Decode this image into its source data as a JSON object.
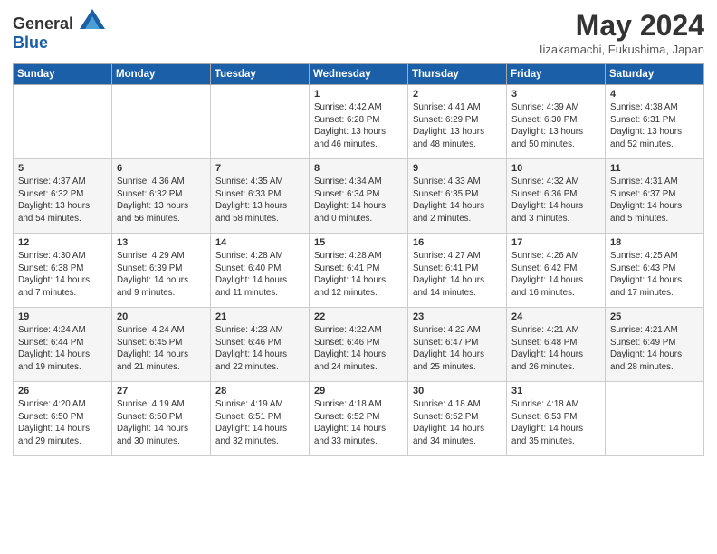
{
  "header": {
    "logo_general": "General",
    "logo_blue": "Blue",
    "month_title": "May 2024",
    "location": "Iizakamachi, Fukushima, Japan"
  },
  "days_of_week": [
    "Sunday",
    "Monday",
    "Tuesday",
    "Wednesday",
    "Thursday",
    "Friday",
    "Saturday"
  ],
  "weeks": [
    [
      {
        "day": "",
        "content": ""
      },
      {
        "day": "",
        "content": ""
      },
      {
        "day": "",
        "content": ""
      },
      {
        "day": "1",
        "content": "Sunrise: 4:42 AM\nSunset: 6:28 PM\nDaylight: 13 hours\nand 46 minutes."
      },
      {
        "day": "2",
        "content": "Sunrise: 4:41 AM\nSunset: 6:29 PM\nDaylight: 13 hours\nand 48 minutes."
      },
      {
        "day": "3",
        "content": "Sunrise: 4:39 AM\nSunset: 6:30 PM\nDaylight: 13 hours\nand 50 minutes."
      },
      {
        "day": "4",
        "content": "Sunrise: 4:38 AM\nSunset: 6:31 PM\nDaylight: 13 hours\nand 52 minutes."
      }
    ],
    [
      {
        "day": "5",
        "content": "Sunrise: 4:37 AM\nSunset: 6:32 PM\nDaylight: 13 hours\nand 54 minutes."
      },
      {
        "day": "6",
        "content": "Sunrise: 4:36 AM\nSunset: 6:32 PM\nDaylight: 13 hours\nand 56 minutes."
      },
      {
        "day": "7",
        "content": "Sunrise: 4:35 AM\nSunset: 6:33 PM\nDaylight: 13 hours\nand 58 minutes."
      },
      {
        "day": "8",
        "content": "Sunrise: 4:34 AM\nSunset: 6:34 PM\nDaylight: 14 hours\nand 0 minutes."
      },
      {
        "day": "9",
        "content": "Sunrise: 4:33 AM\nSunset: 6:35 PM\nDaylight: 14 hours\nand 2 minutes."
      },
      {
        "day": "10",
        "content": "Sunrise: 4:32 AM\nSunset: 6:36 PM\nDaylight: 14 hours\nand 3 minutes."
      },
      {
        "day": "11",
        "content": "Sunrise: 4:31 AM\nSunset: 6:37 PM\nDaylight: 14 hours\nand 5 minutes."
      }
    ],
    [
      {
        "day": "12",
        "content": "Sunrise: 4:30 AM\nSunset: 6:38 PM\nDaylight: 14 hours\nand 7 minutes."
      },
      {
        "day": "13",
        "content": "Sunrise: 4:29 AM\nSunset: 6:39 PM\nDaylight: 14 hours\nand 9 minutes."
      },
      {
        "day": "14",
        "content": "Sunrise: 4:28 AM\nSunset: 6:40 PM\nDaylight: 14 hours\nand 11 minutes."
      },
      {
        "day": "15",
        "content": "Sunrise: 4:28 AM\nSunset: 6:41 PM\nDaylight: 14 hours\nand 12 minutes."
      },
      {
        "day": "16",
        "content": "Sunrise: 4:27 AM\nSunset: 6:41 PM\nDaylight: 14 hours\nand 14 minutes."
      },
      {
        "day": "17",
        "content": "Sunrise: 4:26 AM\nSunset: 6:42 PM\nDaylight: 14 hours\nand 16 minutes."
      },
      {
        "day": "18",
        "content": "Sunrise: 4:25 AM\nSunset: 6:43 PM\nDaylight: 14 hours\nand 17 minutes."
      }
    ],
    [
      {
        "day": "19",
        "content": "Sunrise: 4:24 AM\nSunset: 6:44 PM\nDaylight: 14 hours\nand 19 minutes."
      },
      {
        "day": "20",
        "content": "Sunrise: 4:24 AM\nSunset: 6:45 PM\nDaylight: 14 hours\nand 21 minutes."
      },
      {
        "day": "21",
        "content": "Sunrise: 4:23 AM\nSunset: 6:46 PM\nDaylight: 14 hours\nand 22 minutes."
      },
      {
        "day": "22",
        "content": "Sunrise: 4:22 AM\nSunset: 6:46 PM\nDaylight: 14 hours\nand 24 minutes."
      },
      {
        "day": "23",
        "content": "Sunrise: 4:22 AM\nSunset: 6:47 PM\nDaylight: 14 hours\nand 25 minutes."
      },
      {
        "day": "24",
        "content": "Sunrise: 4:21 AM\nSunset: 6:48 PM\nDaylight: 14 hours\nand 26 minutes."
      },
      {
        "day": "25",
        "content": "Sunrise: 4:21 AM\nSunset: 6:49 PM\nDaylight: 14 hours\nand 28 minutes."
      }
    ],
    [
      {
        "day": "26",
        "content": "Sunrise: 4:20 AM\nSunset: 6:50 PM\nDaylight: 14 hours\nand 29 minutes."
      },
      {
        "day": "27",
        "content": "Sunrise: 4:19 AM\nSunset: 6:50 PM\nDaylight: 14 hours\nand 30 minutes."
      },
      {
        "day": "28",
        "content": "Sunrise: 4:19 AM\nSunset: 6:51 PM\nDaylight: 14 hours\nand 32 minutes."
      },
      {
        "day": "29",
        "content": "Sunrise: 4:18 AM\nSunset: 6:52 PM\nDaylight: 14 hours\nand 33 minutes."
      },
      {
        "day": "30",
        "content": "Sunrise: 4:18 AM\nSunset: 6:52 PM\nDaylight: 14 hours\nand 34 minutes."
      },
      {
        "day": "31",
        "content": "Sunrise: 4:18 AM\nSunset: 6:53 PM\nDaylight: 14 hours\nand 35 minutes."
      },
      {
        "day": "",
        "content": ""
      }
    ]
  ]
}
